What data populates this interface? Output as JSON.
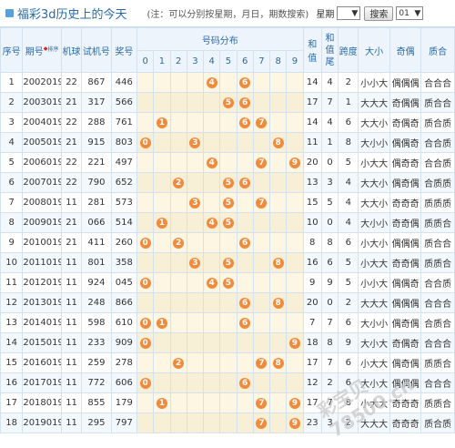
{
  "header": {
    "title": "福彩3d历史上的今天",
    "note": "(注：可以分别按星期，月日，期数搜索)",
    "week_label": "星期",
    "week_value": "",
    "search_label": "搜索",
    "count_value": "01"
  },
  "columns": {
    "seq": "序号",
    "period": "期号",
    "sort": "排序",
    "machine": "机球",
    "test": "试机号",
    "prize": "奖号",
    "dist": "号码分布",
    "sum": "和值",
    "sum_tail": "和值尾",
    "span": "跨度",
    "size": "大小",
    "oddeven": "奇偶",
    "primecomp": "质合",
    "digits": [
      "0",
      "1",
      "2",
      "3",
      "4",
      "5",
      "6",
      "7",
      "8",
      "9"
    ]
  },
  "rows": [
    {
      "seq": "1",
      "period": "2002019",
      "machine": "22",
      "test": "867",
      "prize": "446",
      "digits": [
        4,
        6
      ],
      "sum": "14",
      "tail": "4",
      "span": "2",
      "size": "小小大",
      "oe": "偶偶偶",
      "pc": "合合合"
    },
    {
      "seq": "2",
      "period": "2003019",
      "machine": "21",
      "test": "317",
      "prize": "566",
      "digits": [
        5,
        6
      ],
      "sum": "17",
      "tail": "7",
      "span": "1",
      "size": "大大大",
      "oe": "奇偶偶",
      "pc": "质合合"
    },
    {
      "seq": "3",
      "period": "2004019",
      "machine": "22",
      "test": "288",
      "prize": "761",
      "digits": [
        1,
        6,
        7
      ],
      "sum": "14",
      "tail": "4",
      "span": "6",
      "size": "大大小",
      "oe": "奇偶奇",
      "pc": "质合质"
    },
    {
      "seq": "4",
      "period": "2005019",
      "machine": "21",
      "test": "915",
      "prize": "803",
      "digits": [
        0,
        3,
        8
      ],
      "sum": "11",
      "tail": "1",
      "span": "8",
      "size": "大小小",
      "oe": "偶偶奇",
      "pc": "合合质"
    },
    {
      "seq": "5",
      "period": "2006019",
      "machine": "22",
      "test": "221",
      "prize": "497",
      "digits": [
        4,
        7,
        9
      ],
      "sum": "20",
      "tail": "0",
      "span": "5",
      "size": "小大大",
      "oe": "偶奇奇",
      "pc": "合合质"
    },
    {
      "seq": "6",
      "period": "2007019",
      "machine": "22",
      "test": "790",
      "prize": "652",
      "digits": [
        2,
        5,
        6
      ],
      "sum": "13",
      "tail": "3",
      "span": "4",
      "size": "大大小",
      "oe": "偶奇偶",
      "pc": "合质质"
    },
    {
      "seq": "7",
      "period": "2008019",
      "machine": "11",
      "test": "281",
      "prize": "573",
      "digits": [
        3,
        5,
        7
      ],
      "sum": "15",
      "tail": "5",
      "span": "4",
      "size": "大大小",
      "oe": "奇奇奇",
      "pc": "质质质"
    },
    {
      "seq": "8",
      "period": "2009019",
      "machine": "21",
      "test": "066",
      "prize": "514",
      "digits": [
        1,
        4,
        5
      ],
      "sum": "10",
      "tail": "0",
      "span": "4",
      "size": "大小小",
      "oe": "奇奇偶",
      "pc": "质质合"
    },
    {
      "seq": "9",
      "period": "2010019",
      "machine": "21",
      "test": "411",
      "prize": "260",
      "digits": [
        0,
        2,
        6
      ],
      "sum": "8",
      "tail": "8",
      "span": "6",
      "size": "小大小",
      "oe": "偶偶偶",
      "pc": "质合合"
    },
    {
      "seq": "10",
      "period": "2011019",
      "machine": "11",
      "test": "801",
      "prize": "358",
      "digits": [
        3,
        5,
        8
      ],
      "sum": "16",
      "tail": "6",
      "span": "5",
      "size": "小大大",
      "oe": "奇奇偶",
      "pc": "质质合"
    },
    {
      "seq": "11",
      "period": "2012019",
      "machine": "11",
      "test": "924",
      "prize": "045",
      "digits": [
        0,
        4,
        5
      ],
      "sum": "9",
      "tail": "9",
      "span": "5",
      "size": "小小大",
      "oe": "偶偶奇",
      "pc": "合合质"
    },
    {
      "seq": "12",
      "period": "2013019",
      "machine": "11",
      "test": "248",
      "prize": "866",
      "digits": [
        6,
        8
      ],
      "sum": "20",
      "tail": "0",
      "span": "2",
      "size": "大大大",
      "oe": "偶偶偶",
      "pc": "合合合"
    },
    {
      "seq": "13",
      "period": "2014019",
      "machine": "11",
      "test": "598",
      "prize": "610",
      "digits": [
        0,
        1,
        6
      ],
      "sum": "7",
      "tail": "7",
      "span": "6",
      "size": "大小小",
      "oe": "偶奇偶",
      "pc": "合质合"
    },
    {
      "seq": "14",
      "period": "2015019",
      "machine": "11",
      "test": "233",
      "prize": "909",
      "digits": [
        0,
        9
      ],
      "sum": "18",
      "tail": "8",
      "span": "9",
      "size": "大小大",
      "oe": "奇偶奇",
      "pc": "合合合"
    },
    {
      "seq": "15",
      "period": "2016019",
      "machine": "11",
      "test": "259",
      "prize": "278",
      "digits": [
        2,
        7,
        8
      ],
      "sum": "17",
      "tail": "7",
      "span": "6",
      "size": "小大大",
      "oe": "偶奇偶",
      "pc": "质质合"
    },
    {
      "seq": "16",
      "period": "2017019",
      "machine": "11",
      "test": "772",
      "prize": "606",
      "digits": [
        0,
        6
      ],
      "sum": "12",
      "tail": "2",
      "span": "6",
      "size": "大小大",
      "oe": "偶偶偶",
      "pc": "合合合"
    },
    {
      "seq": "17",
      "period": "2018019",
      "machine": "11",
      "test": "855",
      "prize": "179",
      "digits": [
        1,
        7,
        9
      ],
      "sum": "17",
      "tail": "7",
      "span": "8",
      "size": "小大大",
      "oe": "奇奇奇",
      "pc": "质质合"
    },
    {
      "seq": "18",
      "period": "2019019",
      "machine": "11",
      "test": "295",
      "prize": "797",
      "digits": [
        7,
        9
      ],
      "sum": "23",
      "tail": "3",
      "span": "2",
      "size": "大大大",
      "oe": "奇奇奇",
      "pc": "质合质"
    }
  ],
  "watermark": "彩宝贝 78500.cn",
  "colors": {
    "ball": "#f08a3c",
    "header_text": "#2a6aa8",
    "dist_bg": "#fdf6e3"
  }
}
